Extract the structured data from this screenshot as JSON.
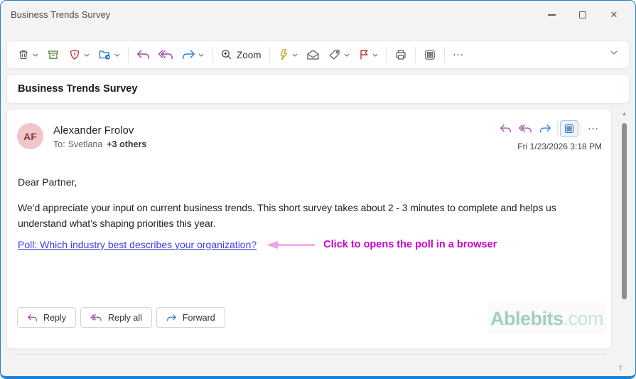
{
  "window": {
    "title": "Business Trends Survey",
    "accent_color": "#1883d7",
    "controls": {
      "minimize": "minimize",
      "maximize": "maximize",
      "close": "close"
    }
  },
  "toolbar": {
    "zoom_label": "Zoom",
    "more_label": "…",
    "items": [
      "delete",
      "archive",
      "report",
      "move-to",
      "reply",
      "reply-all",
      "forward",
      "zoom",
      "quick-steps",
      "read-unread",
      "categorize",
      "flag",
      "print",
      "apps",
      "more",
      "collapse-ribbon"
    ]
  },
  "subject": {
    "title": "Business Trends Survey"
  },
  "message": {
    "sender": {
      "initials": "AF",
      "name": "Alexander Frolov",
      "to_label": "To:",
      "recipient": "Svetlana",
      "others": "+3 others",
      "avatar_bg": "#f2c5c9",
      "avatar_fg": "#7d3c41"
    },
    "timestamp": "Fri 1/23/2026 3:18 PM",
    "header_more": "…",
    "header_icons": [
      "reply",
      "reply-all",
      "forward",
      "apps",
      "more"
    ],
    "body": {
      "greeting": "Dear Partner,",
      "paragraph": "We’d appreciate your input on current business trends. This short survey takes about 2 - 3 minutes to complete and helps us understand what’s shaping priorities this year.",
      "poll_link": "Poll: Which industry best describes your organization?",
      "link_color": "#3e3ee0",
      "annotation": "Click to opens the poll in a browser",
      "annotation_color": "#cc00cc",
      "arrow_color": "#f2a0e8"
    },
    "actions": [
      {
        "label": "Reply"
      },
      {
        "label": "Reply all"
      },
      {
        "label": "Forward"
      }
    ],
    "watermark": {
      "brand": "Ablebits",
      "suffix": ".com"
    }
  },
  "footer": {
    "tiny_label": "T"
  },
  "colors": {
    "reply_purple": "#9b4aa0",
    "forward_blue": "#2b7de1",
    "archive_green": "#587e2a",
    "alert_red": "#c13438",
    "folder_blue": "#1371c8",
    "bolt_gold": "#c9a227",
    "neutral_icon": "#5a5a5a"
  }
}
